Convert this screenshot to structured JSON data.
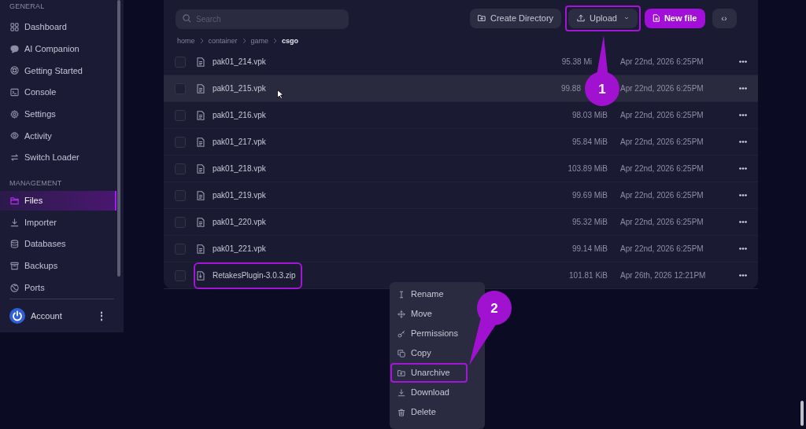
{
  "sidebar": {
    "sections": [
      {
        "title": "GENERAL",
        "items": [
          {
            "label": "Dashboard",
            "selected": false
          },
          {
            "label": "AI Companion",
            "selected": false
          },
          {
            "label": "Getting Started",
            "selected": false
          },
          {
            "label": "Console",
            "selected": false
          },
          {
            "label": "Settings",
            "selected": false
          },
          {
            "label": "Activity",
            "selected": false
          },
          {
            "label": "Switch Loader",
            "selected": false
          }
        ]
      },
      {
        "title": "MANAGEMENT",
        "items": [
          {
            "label": "Files",
            "selected": true
          },
          {
            "label": "Importer",
            "selected": false
          },
          {
            "label": "Databases",
            "selected": false
          },
          {
            "label": "Backups",
            "selected": false
          },
          {
            "label": "Ports",
            "selected": false
          }
        ]
      }
    ],
    "account": {
      "label": "Account",
      "menu": "⋮"
    }
  },
  "toolbar": {
    "search": {
      "placeholder": "Search"
    },
    "buttons": [
      {
        "label": "Create Directory",
        "kind": "secondary",
        "highlighted": false
      },
      {
        "label": "Upload",
        "kind": "dropdown",
        "highlighted": true
      },
      {
        "label": "New file",
        "kind": "primary",
        "highlighted": false
      },
      {
        "label": "‹›",
        "kind": "icon",
        "highlighted": false
      }
    ]
  },
  "breadcrumb": [
    "home",
    "container",
    "game",
    "csgo"
  ],
  "files": [
    {
      "name": "pak01_214.vpk",
      "size": "95.38 Mi",
      "modified": "Apr 22nd, 2026 6:25PM",
      "kind": "file",
      "hovered": false,
      "highlighted": false
    },
    {
      "name": "pak01_215.vpk",
      "size": "99.88",
      "modified": "Apr 22nd, 2026 6:25PM",
      "kind": "file",
      "hovered": true,
      "highlighted": false
    },
    {
      "name": "pak01_216.vpk",
      "size": "98.03 MiB",
      "modified": "Apr 22nd, 2026 6:25PM",
      "kind": "file",
      "hovered": false,
      "highlighted": false
    },
    {
      "name": "pak01_217.vpk",
      "size": "95.84 MiB",
      "modified": "Apr 22nd, 2026 6:25PM",
      "kind": "file",
      "hovered": false,
      "highlighted": false
    },
    {
      "name": "pak01_218.vpk",
      "size": "103.89 MiB",
      "modified": "Apr 22nd, 2026 6:25PM",
      "kind": "file",
      "hovered": false,
      "highlighted": false
    },
    {
      "name": "pak01_219.vpk",
      "size": "99.69 MiB",
      "modified": "Apr 22nd, 2026 6:25PM",
      "kind": "file",
      "hovered": false,
      "highlighted": false
    },
    {
      "name": "pak01_220.vpk",
      "size": "95.32 MiB",
      "modified": "Apr 22nd, 2026 6:25PM",
      "kind": "file",
      "hovered": false,
      "highlighted": false
    },
    {
      "name": "pak01_221.vpk",
      "size": "99.14 MiB",
      "modified": "Apr 22nd, 2026 6:25PM",
      "kind": "file",
      "hovered": false,
      "highlighted": false
    },
    {
      "name": "RetakesPlugin-3.0.3.zip",
      "size": "101.81 KiB",
      "modified": "Apr 26th, 2026 12:21PM",
      "kind": "archive",
      "hovered": false,
      "highlighted": true
    }
  ],
  "context_menu": {
    "items": [
      {
        "label": "Rename",
        "highlighted": false
      },
      {
        "label": "Move",
        "highlighted": false
      },
      {
        "label": "Permissions",
        "highlighted": false
      },
      {
        "label": "Copy",
        "highlighted": false
      },
      {
        "label": "Unarchive",
        "highlighted": true
      },
      {
        "label": "Download",
        "highlighted": false
      },
      {
        "label": "Delete",
        "highlighted": false
      }
    ]
  },
  "annotations": [
    {
      "number": "1"
    },
    {
      "number": "2"
    }
  ]
}
